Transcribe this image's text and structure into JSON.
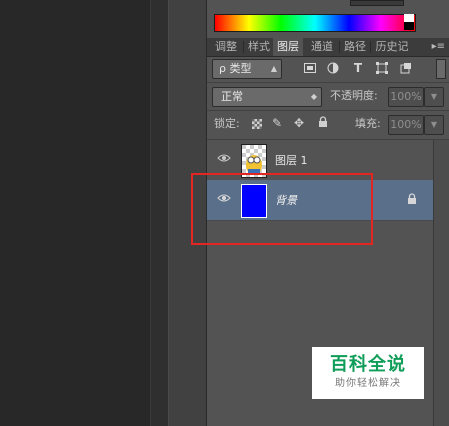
{
  "color_panel": {
    "spectrum_colors": [
      "#ff0000",
      "#ffff00",
      "#00ff00",
      "#00ffff",
      "#0000ff",
      "#ff00ff",
      "#ff0000"
    ]
  },
  "tabs": [
    {
      "label": "调整",
      "active": false
    },
    {
      "label": "样式",
      "active": false
    },
    {
      "label": "图层",
      "active": true
    },
    {
      "label": "通道",
      "active": false
    },
    {
      "label": "路径",
      "active": false
    },
    {
      "label": "历史记",
      "active": false
    }
  ],
  "tab_menu_icon": "panel-menu-icon",
  "filter": {
    "kind_label": "ρ 类型",
    "icons": [
      "image-filter-icon",
      "adjustment-filter-icon",
      "type-filter-icon",
      "shape-filter-icon",
      "smart-object-filter-icon"
    ]
  },
  "blend": {
    "mode": "正常",
    "opacity_label": "不透明度:",
    "opacity_value": "100%"
  },
  "lock": {
    "label": "锁定:",
    "fill_label": "填充:",
    "fill_value": "100%"
  },
  "layers": [
    {
      "name": "图层 1",
      "selected": false,
      "locked": false,
      "thumb_color": "#f1c232"
    },
    {
      "name": "背景",
      "selected": true,
      "locked": true,
      "thumb_color": "#0000ff"
    }
  ],
  "watermark": {
    "title": "百科全说",
    "subtitle": "助你轻松解决"
  },
  "highlight_color": "#e32622"
}
